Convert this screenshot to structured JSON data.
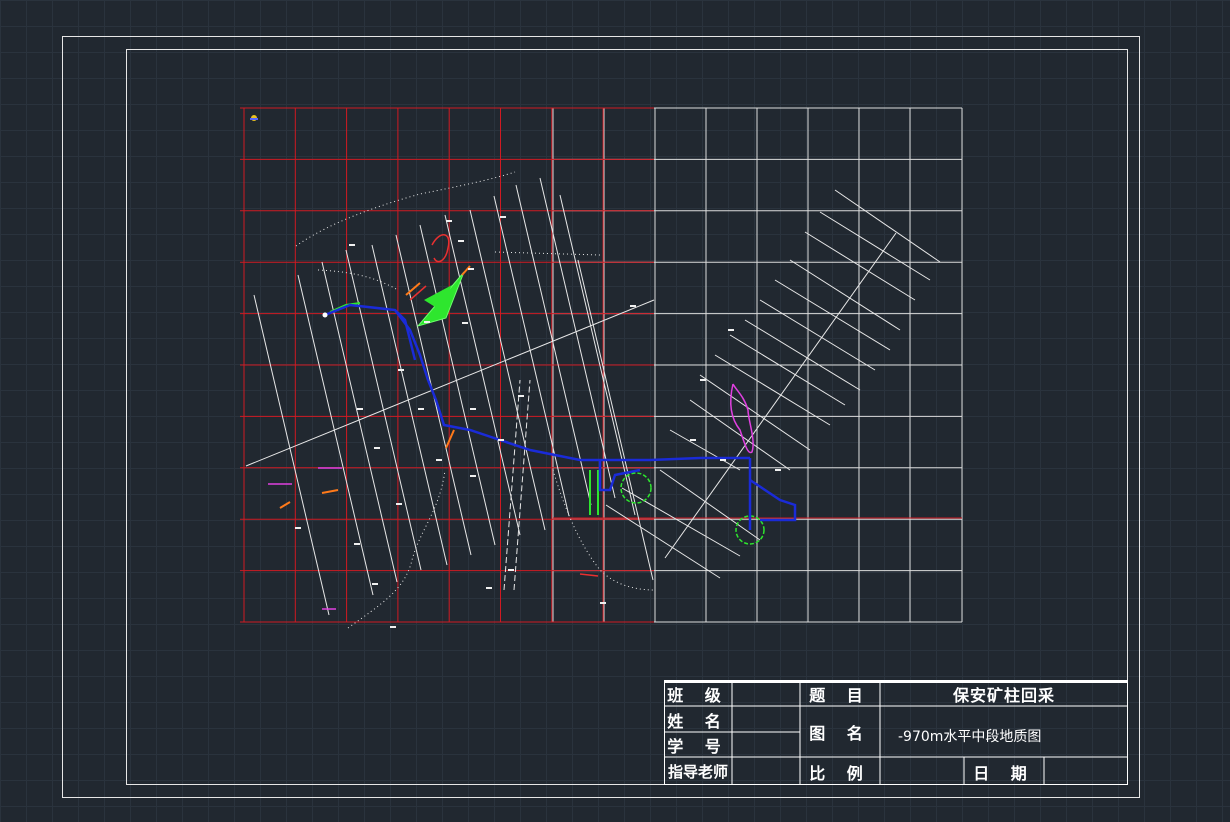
{
  "title_block": {
    "class_label": "班 级",
    "name_label": "姓 名",
    "student_id_label": "学 号",
    "advisor_label": "指导老师",
    "topic_label": "题 目",
    "topic_value": "保安矿柱回采",
    "drawing_name_label": "图 名",
    "drawing_name_value": "-970m水平中段地质图",
    "scale_label": "比 例",
    "date_label": "日 期"
  },
  "colors": {
    "background": "#212830",
    "frame": "#e6e6e6",
    "red_grid": "#d01a22",
    "white_grid": "#dcdcdc",
    "tunnel": "#1a2bd8",
    "orebody": "#2ee62e",
    "magenta": "#e040e0"
  },
  "icons": [
    "compass-marker-icon"
  ]
}
